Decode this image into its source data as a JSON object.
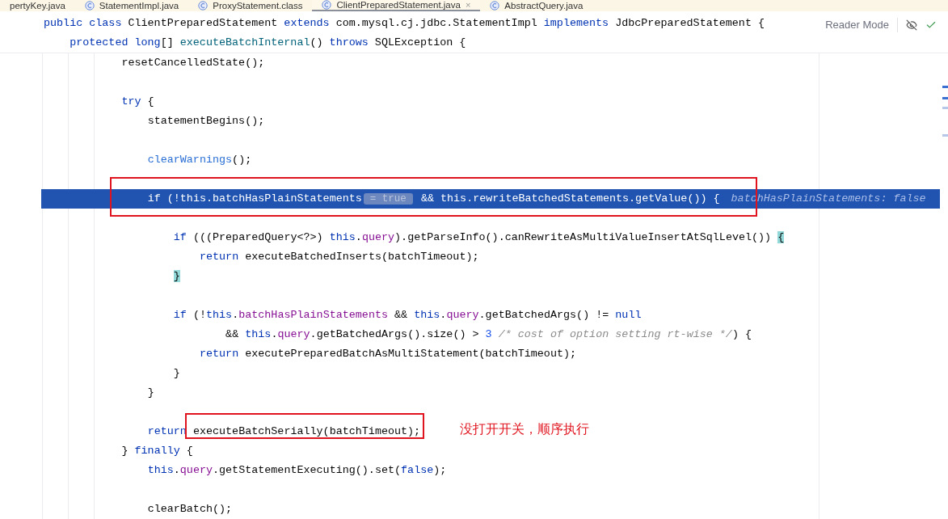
{
  "tabs": [
    {
      "label": "pertyKey.java",
      "icon": false,
      "selected": false
    },
    {
      "label": "StatementImpl.java",
      "icon": true,
      "selected": false
    },
    {
      "label": "ProxyStatement.class",
      "icon": true,
      "selected": false
    },
    {
      "label": "ClientPreparedStatement.java",
      "icon": true,
      "selected": true,
      "close": "×"
    },
    {
      "label": "AbstractQuery.java",
      "icon": true,
      "selected": false
    }
  ],
  "sticky_header": [
    {
      "tokens": [
        {
          "kind": "keyword",
          "text": "public class"
        },
        {
          "kind": "plain",
          "text": " ClientPreparedStatement "
        },
        {
          "kind": "keyword",
          "text": "extends"
        },
        {
          "kind": "plain",
          "text": " com.mysql.cj.jdbc.StatementImpl "
        },
        {
          "kind": "keyword",
          "text": "implements"
        },
        {
          "kind": "plain",
          "text": " JdbcPreparedStatement {"
        }
      ],
      "children": [
        {
          "tokens": [
            {
              "kind": "keyword",
              "text": "protected long"
            },
            {
              "kind": "plain",
              "text": "[] "
            },
            {
              "kind": "method_decl",
              "text": "executeBatchInternal"
            },
            {
              "kind": "plain",
              "text": "() "
            },
            {
              "kind": "keyword",
              "text": "throws"
            },
            {
              "kind": "plain",
              "text": " SQLException {"
            }
          ]
        }
      ]
    }
  ],
  "reader_mode": "Reader Mode",
  "code_lines": [
    {
      "kind": "code",
      "highlighted": false,
      "tokens": [
        {
          "kind": "plain",
          "text": "resetCancelledState();"
        }
      ]
    },
    {
      "kind": "blank"
    },
    {
      "kind": "code",
      "highlighted": false,
      "tokens": [
        {
          "kind": "keyword",
          "text": "try"
        },
        {
          "kind": "plain",
          "text": " {"
        }
      ],
      "children": [
        {
          "kind": "code",
          "highlighted": false,
          "tokens": [
            {
              "kind": "plain",
              "text": "statementBegins();"
            }
          ]
        },
        {
          "kind": "blank"
        },
        {
          "kind": "code",
          "highlighted": false,
          "tokens": [
            {
              "kind": "method_link",
              "text": "clearWarnings"
            },
            {
              "kind": "plain",
              "text": "();"
            }
          ]
        },
        {
          "kind": "blank"
        },
        {
          "kind": "code",
          "highlighted": true,
          "tokens": [
            {
              "kind": "keyword",
              "text": "if"
            },
            {
              "kind": "plain",
              "text": " (!"
            },
            {
              "kind": "keyword",
              "text": "this"
            },
            {
              "kind": "plain",
              "text": "."
            },
            {
              "kind": "field",
              "text": "batchHasPlainStatements"
            },
            {
              "kind": "inlay",
              "text": "= true"
            },
            {
              "kind": "plain",
              "text": " && "
            },
            {
              "kind": "keyword",
              "text": "this"
            },
            {
              "kind": "plain",
              "text": "."
            },
            {
              "kind": "field",
              "text": "rewriteBatchedStatements"
            },
            {
              "kind": "plain",
              "text": ".getValue()) {"
            },
            {
              "kind": "hint",
              "text": "batchHasPlainStatements: false"
            }
          ],
          "children": [
            {
              "kind": "blank"
            },
            {
              "kind": "code",
              "highlighted": false,
              "tokens": [
                {
                  "kind": "keyword",
                  "text": "if"
                },
                {
                  "kind": "plain",
                  "text": " (((PreparedQuery<?>) "
                },
                {
                  "kind": "keyword",
                  "text": "this"
                },
                {
                  "kind": "plain",
                  "text": "."
                },
                {
                  "kind": "field",
                  "text": "query"
                },
                {
                  "kind": "plain",
                  "text": ").getParseInfo().canRewriteAsMultiValueInsertAtSqlLevel()) "
                },
                {
                  "kind": "brace_match",
                  "text": "{"
                }
              ],
              "children": [
                {
                  "kind": "code",
                  "highlighted": false,
                  "tokens": [
                    {
                      "kind": "keyword",
                      "text": "return"
                    },
                    {
                      "kind": "plain",
                      "text": " executeBatchedInserts(batchTimeout);"
                    }
                  ]
                }
              ]
            },
            {
              "kind": "code",
              "highlighted": false,
              "tokens": [
                {
                  "kind": "brace_match",
                  "text": "}"
                }
              ]
            },
            {
              "kind": "blank"
            },
            {
              "kind": "code",
              "highlighted": false,
              "tokens": [
                {
                  "kind": "keyword",
                  "text": "if"
                },
                {
                  "kind": "plain",
                  "text": " (!"
                },
                {
                  "kind": "keyword",
                  "text": "this"
                },
                {
                  "kind": "plain",
                  "text": "."
                },
                {
                  "kind": "field",
                  "text": "batchHasPlainStatements"
                },
                {
                  "kind": "plain",
                  "text": " && "
                },
                {
                  "kind": "keyword",
                  "text": "this"
                },
                {
                  "kind": "plain",
                  "text": "."
                },
                {
                  "kind": "field",
                  "text": "query"
                },
                {
                  "kind": "plain",
                  "text": ".getBatchedArgs() != "
                },
                {
                  "kind": "keyword",
                  "text": "null"
                }
              ],
              "children": [
                {
                  "kind": "continuation",
                  "highlighted": false,
                  "tokens": [
                    {
                      "kind": "plain",
                      "text": "&& "
                    },
                    {
                      "kind": "keyword",
                      "text": "this"
                    },
                    {
                      "kind": "plain",
                      "text": "."
                    },
                    {
                      "kind": "field",
                      "text": "query"
                    },
                    {
                      "kind": "plain",
                      "text": ".getBatchedArgs().size() > "
                    },
                    {
                      "kind": "number",
                      "text": "3"
                    },
                    {
                      "kind": "comment",
                      "text": "/* cost of option setting rt-wise */"
                    },
                    {
                      "kind": "plain",
                      "text": ") {"
                    }
                  ]
                },
                {
                  "kind": "code",
                  "highlighted": false,
                  "tokens": [
                    {
                      "kind": "keyword",
                      "text": "return"
                    },
                    {
                      "kind": "plain",
                      "text": " executePreparedBatchAsMultiStatement(batchTimeout);"
                    }
                  ]
                }
              ]
            },
            {
              "kind": "code",
              "highlighted": false,
              "tokens": [
                {
                  "kind": "plain",
                  "text": "}"
                }
              ]
            }
          ]
        },
        {
          "kind": "code",
          "highlighted": false,
          "tokens": [
            {
              "kind": "plain",
              "text": "}"
            }
          ]
        },
        {
          "kind": "blank"
        },
        {
          "kind": "code",
          "highlighted": false,
          "tokens": [
            {
              "kind": "keyword",
              "text": "return"
            },
            {
              "kind": "plain",
              "text": " executeBatchSerially(batchTimeout);"
            }
          ]
        }
      ]
    },
    {
      "kind": "code",
      "highlighted": false,
      "tokens": [
        {
          "kind": "plain",
          "text": "} "
        },
        {
          "kind": "keyword",
          "text": "finally"
        },
        {
          "kind": "plain",
          "text": " {"
        }
      ],
      "children": [
        {
          "kind": "code",
          "highlighted": false,
          "tokens": [
            {
              "kind": "keyword",
              "text": "this"
            },
            {
              "kind": "plain",
              "text": "."
            },
            {
              "kind": "field",
              "text": "query"
            },
            {
              "kind": "plain",
              "text": ".getStatementExecuting().set("
            },
            {
              "kind": "keyword",
              "text": "false"
            },
            {
              "kind": "plain",
              "text": ");"
            }
          ]
        },
        {
          "kind": "blank"
        },
        {
          "kind": "code",
          "highlighted": false,
          "tokens": [
            {
              "kind": "plain",
              "text": "clearBatch();"
            }
          ]
        }
      ]
    }
  ],
  "annotations": [
    {
      "kind": "box"
    },
    {
      "kind": "box"
    },
    {
      "kind": "note",
      "text": "没打开开关，顺序执行"
    }
  ]
}
